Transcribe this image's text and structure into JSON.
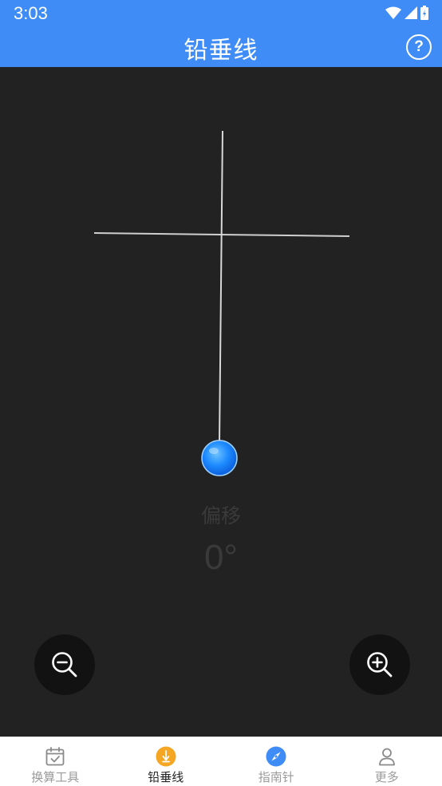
{
  "status_bar": {
    "time": "3:03"
  },
  "app_bar": {
    "title": "铅垂线",
    "help_icon": "question-circle-icon"
  },
  "plumb": {
    "offset_label": "偏移",
    "offset_value": "0°",
    "bob_color": "#1E90FF"
  },
  "controls": {
    "zoom_out_icon": "zoom-out-icon",
    "zoom_in_icon": "zoom-in-icon"
  },
  "bottom_nav": {
    "items": [
      {
        "label": "换算工具",
        "icon": "calendar-check-icon",
        "active": false
      },
      {
        "label": "铅垂线",
        "icon": "plumb-icon",
        "active": true
      },
      {
        "label": "指南针",
        "icon": "compass-icon",
        "active": false
      },
      {
        "label": "更多",
        "icon": "person-icon",
        "active": false
      }
    ]
  },
  "colors": {
    "primary": "#3F8CF6",
    "background": "#222222",
    "accent_orange": "#F5A623"
  }
}
